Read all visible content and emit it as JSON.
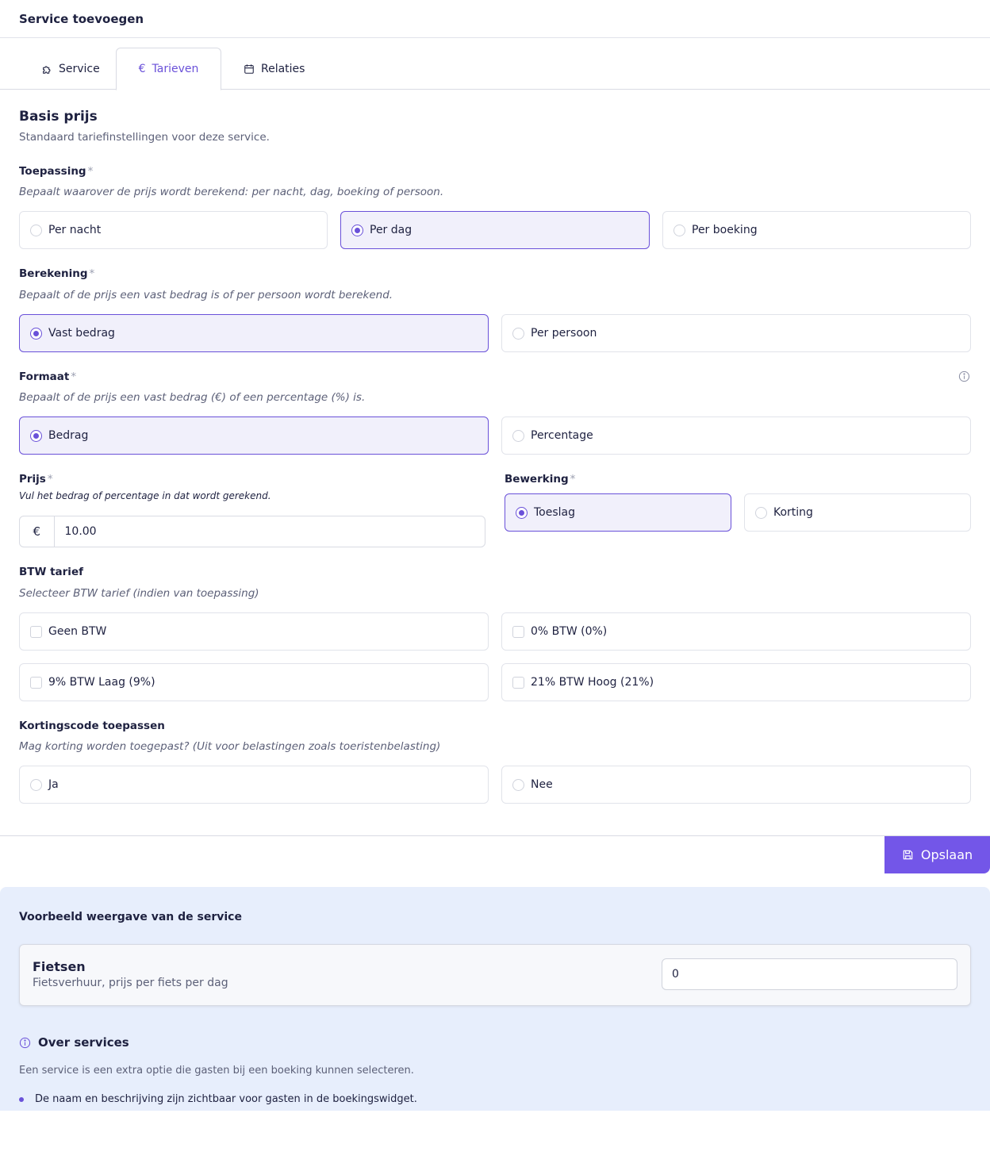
{
  "header": {
    "title": "Service toevoegen"
  },
  "tabs": [
    {
      "label": "Service",
      "icon": "puzzle-icon"
    },
    {
      "label": "Tarieven",
      "icon": "euro-icon",
      "active": true
    },
    {
      "label": "Relaties",
      "icon": "calendar-icon"
    }
  ],
  "basis": {
    "title": "Basis prijs",
    "subtitle": "Standaard tariefinstellingen voor deze service."
  },
  "toepassing": {
    "label": "Toepassing",
    "required": "*",
    "hint": "Bepaalt waarover de prijs wordt berekend: per nacht, dag, boeking of persoon.",
    "options": [
      "Per nacht",
      "Per dag",
      "Per boeking"
    ],
    "selected": "Per dag"
  },
  "berekening": {
    "label": "Berekening",
    "required": "*",
    "hint": "Bepaalt of de prijs een vast bedrag is of per persoon wordt berekend.",
    "options": [
      "Vast bedrag",
      "Per persoon"
    ],
    "selected": "Vast bedrag"
  },
  "formaat": {
    "label": "Formaat",
    "required": "*",
    "hint": "Bepaalt of de prijs een vast bedrag (€) of een percentage (%) is.",
    "options": [
      "Bedrag",
      "Percentage"
    ],
    "selected": "Bedrag"
  },
  "prijs": {
    "label": "Prijs",
    "required": "*",
    "hint": "Vul het bedrag of percentage in dat wordt gerekend.",
    "currency": "€",
    "value": "10.00"
  },
  "bewerking": {
    "label": "Bewerking",
    "required": "*",
    "options": [
      "Toeslag",
      "Korting"
    ],
    "selected": "Toeslag"
  },
  "btw": {
    "label": "BTW tarief",
    "hint": "Selecteer BTW tarief (indien van toepassing)",
    "options": [
      "Geen BTW",
      "0% BTW (0%)",
      "9% BTW Laag (9%)",
      "21% BTW Hoog (21%)"
    ]
  },
  "korting": {
    "label": "Kortingscode toepassen",
    "hint": "Mag korting worden toegepast? (Uit voor belastingen zoals toeristenbelasting)",
    "options": [
      "Ja",
      "Nee"
    ]
  },
  "footer": {
    "save_label": "Opslaan"
  },
  "preview": {
    "title": "Voorbeeld weergave van de service",
    "service_name": "Fietsen",
    "service_description": "Fietsverhuur, prijs per fiets per dag",
    "quantity": "0"
  },
  "over": {
    "title": "Over services",
    "text": "Een service is een extra optie die gasten bij een boeking kunnen selecteren.",
    "bullets": [
      "De naam en beschrijving zijn zichtbaar voor gasten in de boekingswidget."
    ]
  },
  "colors": {
    "accent": "#7356e8",
    "selected_bg": "#f1f0fb",
    "preview_bg": "#e7eefc"
  }
}
